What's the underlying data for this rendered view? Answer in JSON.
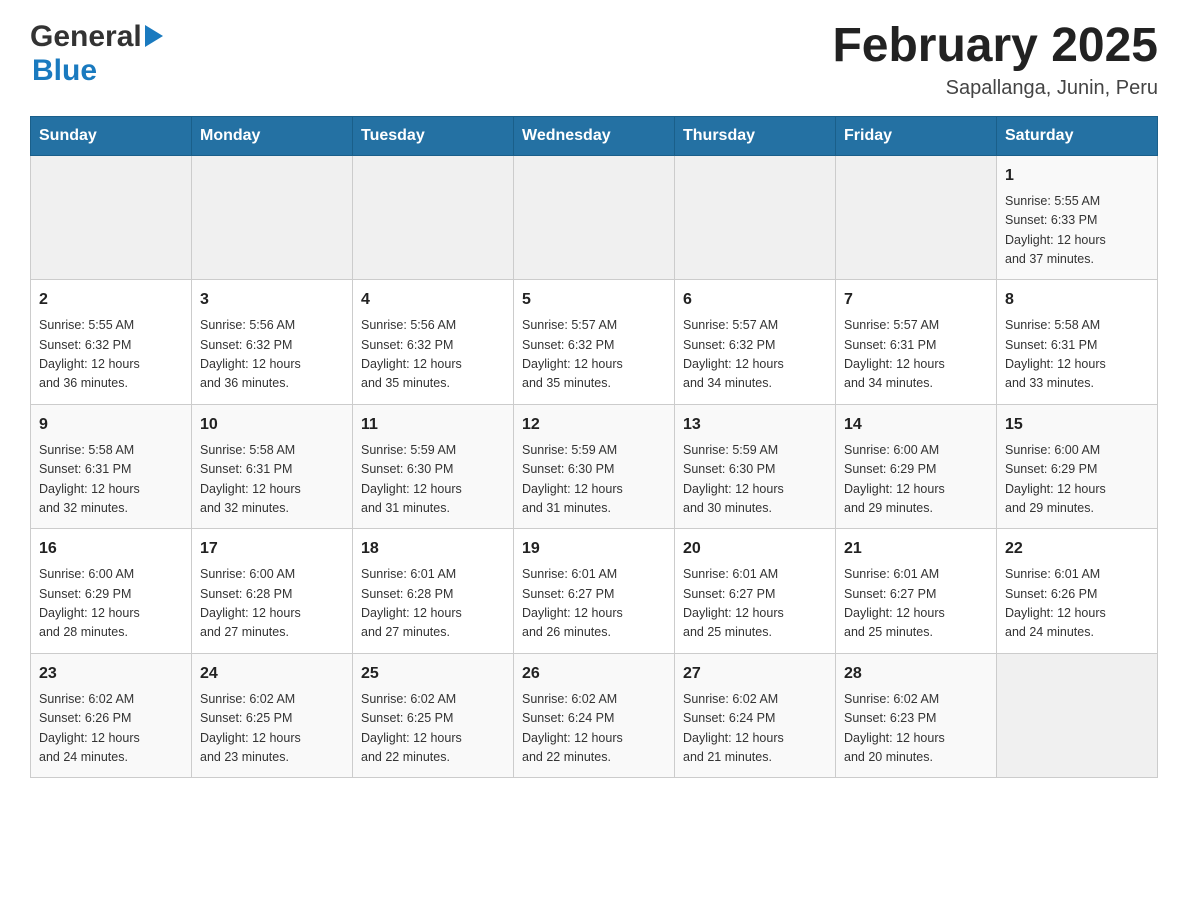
{
  "header": {
    "logo_general": "General",
    "logo_blue": "Blue",
    "title": "February 2025",
    "location": "Sapallanga, Junin, Peru"
  },
  "days_of_week": [
    "Sunday",
    "Monday",
    "Tuesday",
    "Wednesday",
    "Thursday",
    "Friday",
    "Saturday"
  ],
  "weeks": [
    [
      {
        "day": "",
        "info": ""
      },
      {
        "day": "",
        "info": ""
      },
      {
        "day": "",
        "info": ""
      },
      {
        "day": "",
        "info": ""
      },
      {
        "day": "",
        "info": ""
      },
      {
        "day": "",
        "info": ""
      },
      {
        "day": "1",
        "info": "Sunrise: 5:55 AM\nSunset: 6:33 PM\nDaylight: 12 hours\nand 37 minutes."
      }
    ],
    [
      {
        "day": "2",
        "info": "Sunrise: 5:55 AM\nSunset: 6:32 PM\nDaylight: 12 hours\nand 36 minutes."
      },
      {
        "day": "3",
        "info": "Sunrise: 5:56 AM\nSunset: 6:32 PM\nDaylight: 12 hours\nand 36 minutes."
      },
      {
        "day": "4",
        "info": "Sunrise: 5:56 AM\nSunset: 6:32 PM\nDaylight: 12 hours\nand 35 minutes."
      },
      {
        "day": "5",
        "info": "Sunrise: 5:57 AM\nSunset: 6:32 PM\nDaylight: 12 hours\nand 35 minutes."
      },
      {
        "day": "6",
        "info": "Sunrise: 5:57 AM\nSunset: 6:32 PM\nDaylight: 12 hours\nand 34 minutes."
      },
      {
        "day": "7",
        "info": "Sunrise: 5:57 AM\nSunset: 6:31 PM\nDaylight: 12 hours\nand 34 minutes."
      },
      {
        "day": "8",
        "info": "Sunrise: 5:58 AM\nSunset: 6:31 PM\nDaylight: 12 hours\nand 33 minutes."
      }
    ],
    [
      {
        "day": "9",
        "info": "Sunrise: 5:58 AM\nSunset: 6:31 PM\nDaylight: 12 hours\nand 32 minutes."
      },
      {
        "day": "10",
        "info": "Sunrise: 5:58 AM\nSunset: 6:31 PM\nDaylight: 12 hours\nand 32 minutes."
      },
      {
        "day": "11",
        "info": "Sunrise: 5:59 AM\nSunset: 6:30 PM\nDaylight: 12 hours\nand 31 minutes."
      },
      {
        "day": "12",
        "info": "Sunrise: 5:59 AM\nSunset: 6:30 PM\nDaylight: 12 hours\nand 31 minutes."
      },
      {
        "day": "13",
        "info": "Sunrise: 5:59 AM\nSunset: 6:30 PM\nDaylight: 12 hours\nand 30 minutes."
      },
      {
        "day": "14",
        "info": "Sunrise: 6:00 AM\nSunset: 6:29 PM\nDaylight: 12 hours\nand 29 minutes."
      },
      {
        "day": "15",
        "info": "Sunrise: 6:00 AM\nSunset: 6:29 PM\nDaylight: 12 hours\nand 29 minutes."
      }
    ],
    [
      {
        "day": "16",
        "info": "Sunrise: 6:00 AM\nSunset: 6:29 PM\nDaylight: 12 hours\nand 28 minutes."
      },
      {
        "day": "17",
        "info": "Sunrise: 6:00 AM\nSunset: 6:28 PM\nDaylight: 12 hours\nand 27 minutes."
      },
      {
        "day": "18",
        "info": "Sunrise: 6:01 AM\nSunset: 6:28 PM\nDaylight: 12 hours\nand 27 minutes."
      },
      {
        "day": "19",
        "info": "Sunrise: 6:01 AM\nSunset: 6:27 PM\nDaylight: 12 hours\nand 26 minutes."
      },
      {
        "day": "20",
        "info": "Sunrise: 6:01 AM\nSunset: 6:27 PM\nDaylight: 12 hours\nand 25 minutes."
      },
      {
        "day": "21",
        "info": "Sunrise: 6:01 AM\nSunset: 6:27 PM\nDaylight: 12 hours\nand 25 minutes."
      },
      {
        "day": "22",
        "info": "Sunrise: 6:01 AM\nSunset: 6:26 PM\nDaylight: 12 hours\nand 24 minutes."
      }
    ],
    [
      {
        "day": "23",
        "info": "Sunrise: 6:02 AM\nSunset: 6:26 PM\nDaylight: 12 hours\nand 24 minutes."
      },
      {
        "day": "24",
        "info": "Sunrise: 6:02 AM\nSunset: 6:25 PM\nDaylight: 12 hours\nand 23 minutes."
      },
      {
        "day": "25",
        "info": "Sunrise: 6:02 AM\nSunset: 6:25 PM\nDaylight: 12 hours\nand 22 minutes."
      },
      {
        "day": "26",
        "info": "Sunrise: 6:02 AM\nSunset: 6:24 PM\nDaylight: 12 hours\nand 22 minutes."
      },
      {
        "day": "27",
        "info": "Sunrise: 6:02 AM\nSunset: 6:24 PM\nDaylight: 12 hours\nand 21 minutes."
      },
      {
        "day": "28",
        "info": "Sunrise: 6:02 AM\nSunset: 6:23 PM\nDaylight: 12 hours\nand 20 minutes."
      },
      {
        "day": "",
        "info": ""
      }
    ]
  ]
}
